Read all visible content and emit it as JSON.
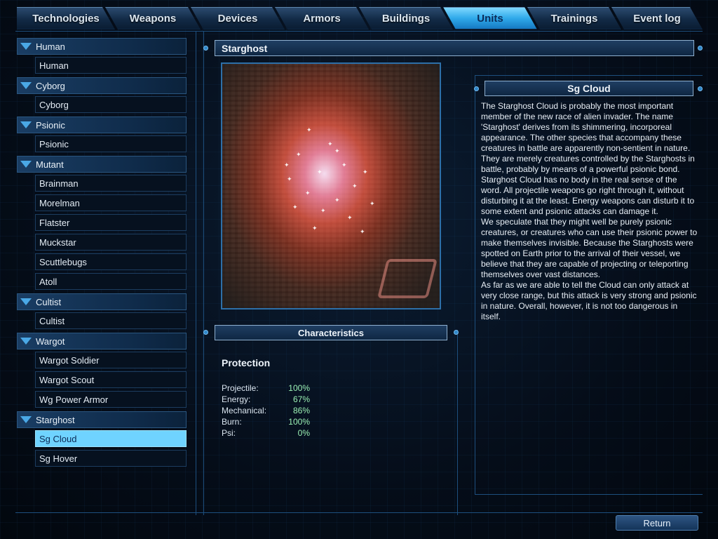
{
  "tabs": [
    "Technologies",
    "Weapons",
    "Devices",
    "Armors",
    "Buildings",
    "Units",
    "Trainings",
    "Event log"
  ],
  "active_tab": "Units",
  "groups": [
    {
      "label": "Human",
      "items": [
        "Human"
      ]
    },
    {
      "label": "Cyborg",
      "items": [
        "Cyborg"
      ]
    },
    {
      "label": "Psionic",
      "items": [
        "Psionic"
      ]
    },
    {
      "label": "Mutant",
      "items": [
        "Brainman",
        "Morelman",
        "Flatster",
        "Muckstar",
        "Scuttlebugs",
        "Atoll"
      ]
    },
    {
      "label": "Cultist",
      "items": [
        "Cultist"
      ]
    },
    {
      "label": "Wargot",
      "items": [
        "Wargot Soldier",
        "Wargot Scout",
        "Wg Power Armor"
      ]
    },
    {
      "label": "Starghost",
      "items": [
        "Sg Cloud",
        "Sg Hover"
      ]
    }
  ],
  "selected_item": "Sg Cloud",
  "category_title": "Starghost",
  "unit_title": "Sg Cloud",
  "characteristics_title": "Characteristics",
  "protection": {
    "title": "Protection",
    "rows": [
      {
        "label": "Projectile:",
        "value": "100%"
      },
      {
        "label": "Energy:",
        "value": "67%"
      },
      {
        "label": "Mechanical:",
        "value": "86%"
      },
      {
        "label": "Burn:",
        "value": "100%"
      },
      {
        "label": "Psi:",
        "value": "0%"
      }
    ]
  },
  "description": "The Starghost Cloud is probably the most important member of the new race of alien invader. The name 'Starghost' derives from its shimmering, incorporeal appearance. The other species that accompany these creatures in battle are apparently non-sentient in nature. They are merely creatures controlled by the Starghosts in battle, probably by means of a powerful psionic bond.\nStarghost Cloud has no body in the real sense of the word. All projectile weapons go right through it, without disturbing it at the least. Energy weapons can disturb it to some extent and psionic attacks can damage it.\nWe speculate that they might well be purely psionic creatures, or creatures who can use their psionic power to make themselves invisible. Because the Starghosts were spotted on Earth prior to the arrival of their vessel, we believe that they are capable of projecting or teleporting themselves over vast distances.\nAs far as we are able to tell the Cloud can only attack at very close range, but this attack is very strong and psionic in nature. Overall, however, it is not too dangerous in itself.",
  "return_label": "Return",
  "colors": {
    "accent": "#2fa9ea",
    "selected_bg": "#6fd3ff",
    "value_green": "#9af0b4",
    "panel_bg": "#06111f"
  }
}
